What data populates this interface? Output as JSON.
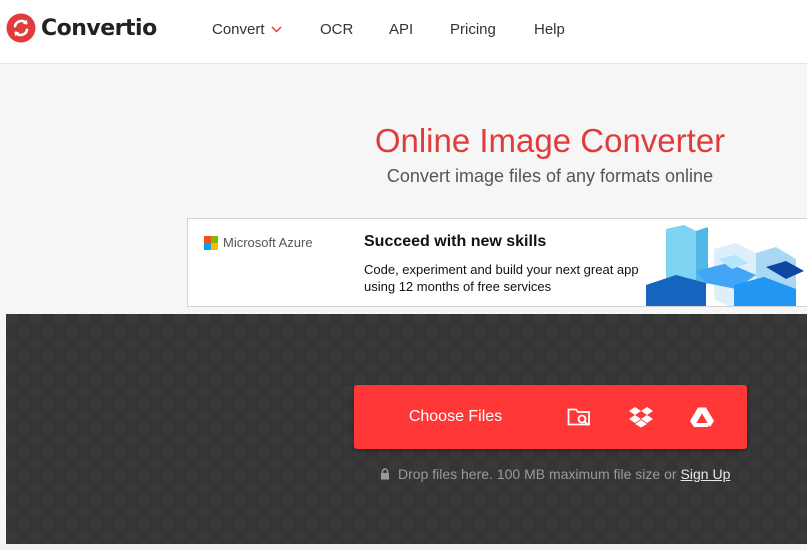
{
  "brand": {
    "name": "Convertio",
    "accent_color": "#e23b3b",
    "logo_icon": "convertio-logo-icon"
  },
  "nav": {
    "convert_label": "Convert",
    "ocr_label": "OCR",
    "api_label": "API",
    "pricing_label": "Pricing",
    "help_label": "Help"
  },
  "hero": {
    "title": "Online Image Converter",
    "subtitle": "Convert image files of any formats online"
  },
  "ad": {
    "brand": "Microsoft Azure",
    "headline": "Succeed with new skills",
    "body": "Code, experiment and build your next great app using 12 months of free services",
    "ms_colors": [
      "#f25022",
      "#7fba00",
      "#00a4ef",
      "#ffb900"
    ]
  },
  "upload": {
    "choose_label": "Choose Files",
    "button_color": "#ff3737",
    "sources": [
      "folder-search-icon",
      "dropbox-icon",
      "google-drive-icon"
    ],
    "drop_text": "Drop files here. 100 MB maximum file size or",
    "signup_label": "Sign Up"
  }
}
